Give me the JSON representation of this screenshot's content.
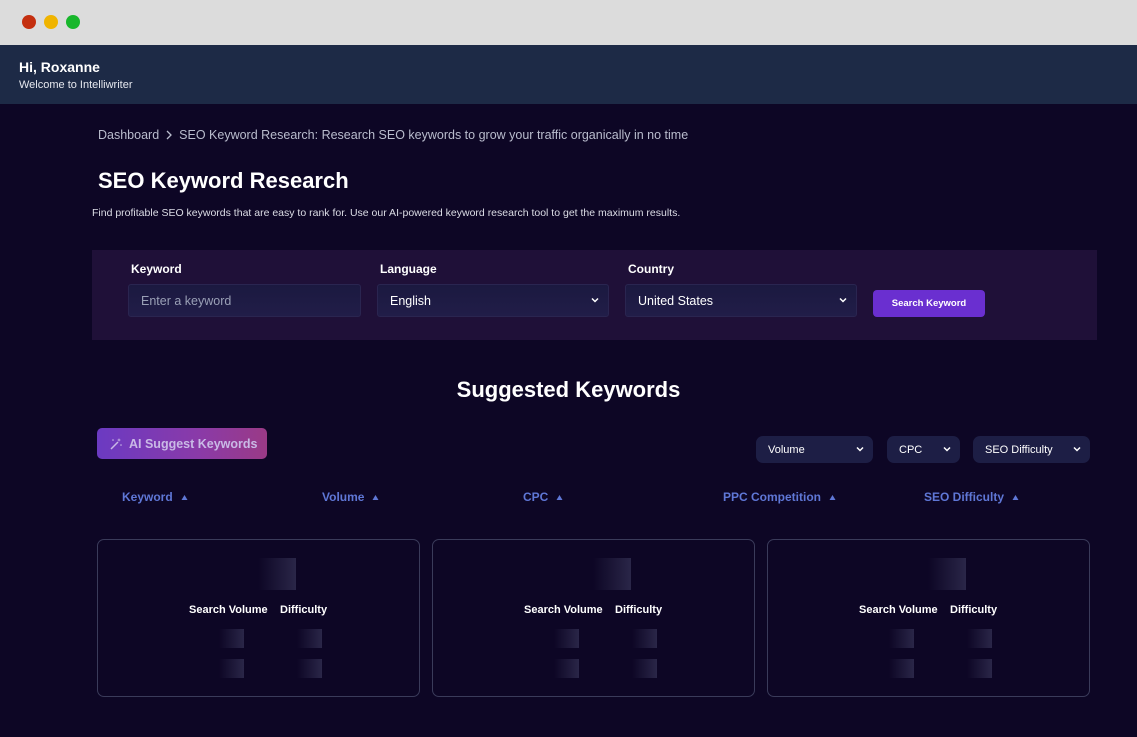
{
  "header": {
    "greeting": "Hi, Roxanne",
    "welcome": "Welcome to Intelliwriter"
  },
  "breadcrumb": {
    "root": "Dashboard",
    "current": "SEO Keyword Research:  Research SEO keywords to grow your traffic organically in no time"
  },
  "page": {
    "title": "SEO Keyword Research",
    "subtitle": "Find profitable SEO keywords that are easy to rank for. Use our AI-powered keyword research tool to get the maximum results."
  },
  "search": {
    "keyword_label": "Keyword",
    "keyword_placeholder": "Enter a keyword",
    "language_label": "Language",
    "language_value": "English",
    "country_label": "Country",
    "country_value": "United States",
    "button": "Search Keyword"
  },
  "suggested": {
    "title": "Suggested Keywords",
    "ai_button": "AI Suggest Keywords",
    "filters": [
      "Volume",
      "CPC",
      "SEO Difficulty"
    ],
    "columns": [
      "Keyword",
      "Volume",
      "CPC",
      "PPC Competition",
      "SEO Difficulty"
    ],
    "cards": [
      {
        "search_volume_label": "Search Volume",
        "difficulty_label": "Difficulty"
      },
      {
        "search_volume_label": "Search Volume",
        "difficulty_label": "Difficulty"
      },
      {
        "search_volume_label": "Search Volume",
        "difficulty_label": "Difficulty"
      }
    ]
  },
  "colors": {
    "background": "#0d0625",
    "topbar": "#1d2a46",
    "panel": "#1f1038",
    "accent": "#6a2fd0",
    "column_header": "#5f77d6"
  }
}
